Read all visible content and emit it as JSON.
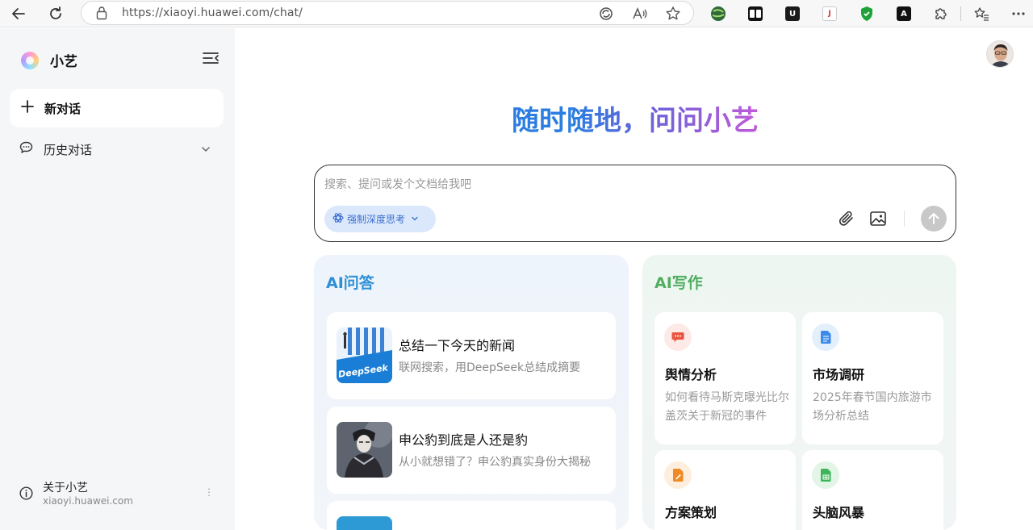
{
  "browser": {
    "url": "https://xiaoyi.huawei.com/chat/"
  },
  "sidebar": {
    "brand": "小艺",
    "new_chat": "新对话",
    "history": "历史对话",
    "about_title": "关于小艺",
    "about_domain": "xiaoyi.huawei.com",
    "about_more": "⋮"
  },
  "main": {
    "hero": "随时随地，问问小艺",
    "input_placeholder": "搜索、提问或发个文档给我吧",
    "deep_think": "强制深度思考"
  },
  "qa": {
    "title": "AI问答",
    "cards": [
      {
        "title": "总结一下今天的新闻",
        "subtitle": "联网搜索，用DeepSeek总结成摘要",
        "thumb_text": "DeepSeek"
      },
      {
        "title": "申公豹到底是人还是豹",
        "subtitle": "从小就想错了？申公豹真实身份大揭秘"
      },
      {
        "title": "",
        "subtitle": ""
      }
    ]
  },
  "write": {
    "title": "AI写作",
    "cards": [
      {
        "title": "舆情分析",
        "subtitle": "如何看待马斯克曝光比尔盖茨关于新冠的事件",
        "icon": "chat-bubble-icon",
        "color": "#e9543f"
      },
      {
        "title": "市场调研",
        "subtitle": "2025年春节国内旅游市场分析总结",
        "icon": "document-icon",
        "color": "#3d8be8"
      },
      {
        "title": "方案策划",
        "subtitle": "",
        "icon": "pencil-doc-icon",
        "color": "#f08a24"
      },
      {
        "title": "头脑风暴",
        "subtitle": "",
        "icon": "spreadsheet-icon",
        "color": "#3fb55a"
      }
    ]
  },
  "colors": {
    "qa_accent": "#2f8fd6",
    "write_accent": "#4fae5f",
    "hero_start": "#2b7de0",
    "hero_end": "#c05ad8"
  }
}
